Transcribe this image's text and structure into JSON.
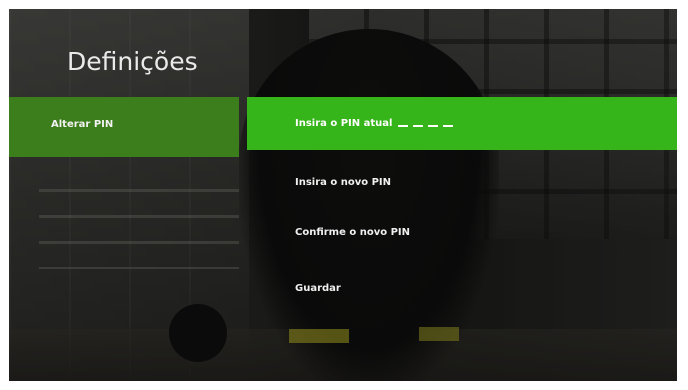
{
  "page": {
    "title": "Definições"
  },
  "menu": {
    "items": [
      {
        "label": "Alterar PIN",
        "selected": true
      }
    ]
  },
  "form": {
    "current_pin_label": "Insira o PIN atual",
    "current_pin_length": 4,
    "new_pin_label": "Insira o novo PIN",
    "confirm_pin_label": "Confirme o novo PIN",
    "save_label": "Guardar"
  },
  "colors": {
    "accent": "#36b51a",
    "menu_selected": "#3c7e1c"
  }
}
